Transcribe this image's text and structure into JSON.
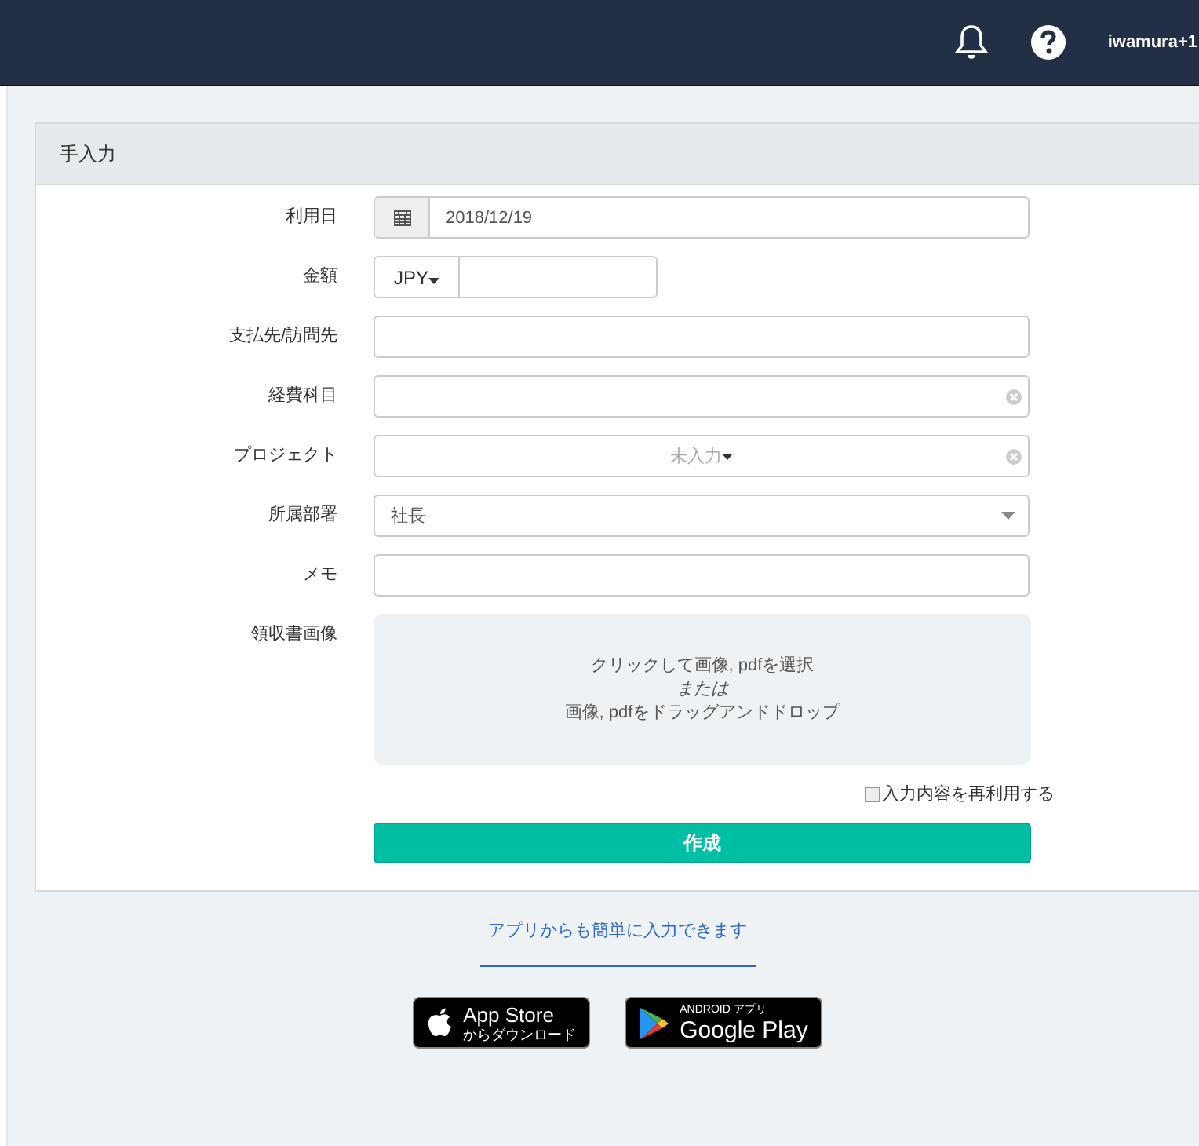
{
  "header": {
    "user": "iwamura+1"
  },
  "panel": {
    "title": "手入力"
  },
  "fields": [
    {
      "kind": "date",
      "label": "利用日",
      "value": "2018/12/19"
    },
    {
      "kind": "currency",
      "label": "金額",
      "currency": "JPY"
    },
    {
      "kind": "text",
      "label": "支払先/訪問先"
    },
    {
      "kind": "clearable",
      "label": "経費科目"
    },
    {
      "kind": "clearable",
      "label": "プロジェクト",
      "placeholder": "未入力"
    },
    {
      "kind": "select",
      "label": "所属部署",
      "value": "社長"
    },
    {
      "kind": "text",
      "label": "メモ"
    },
    {
      "kind": "upload",
      "label": "領収書画像",
      "lines": [
        "クリックして画像, pdfを選択",
        "または",
        "画像, pdfをドラッグアンドドロップ"
      ]
    }
  ],
  "reuse": {
    "label": "入力内容を再利用する",
    "checked": false
  },
  "submit": "作成",
  "app_link": "アプリからも簡単に入力できます",
  "badges": [
    {
      "kind": "apple",
      "top": "App Store",
      "bottom": "からダウンロード"
    },
    {
      "kind": "google",
      "top": "ANDROID アプリ",
      "bottom": "Google Play"
    }
  ]
}
